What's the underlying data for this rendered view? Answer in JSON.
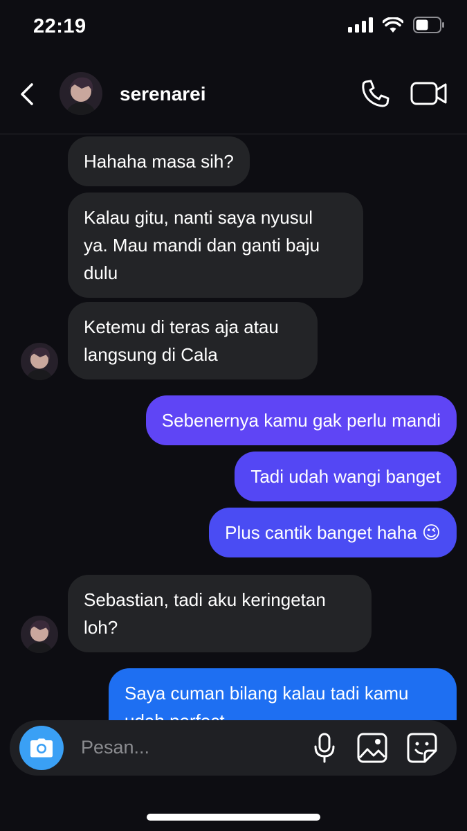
{
  "status": {
    "time": "22:19"
  },
  "header": {
    "username": "serenarei",
    "back_icon": "chevron-left-icon",
    "call_icon": "phone-icon",
    "video_icon": "video-camera-icon"
  },
  "messages": [
    {
      "from": "them",
      "text": "Hahaha masa sih?"
    },
    {
      "from": "them",
      "lines": [
        "Kalau gitu, nanti saya nyusul",
        "ya. Mau mandi dan ganti baju",
        "dulu"
      ]
    },
    {
      "from": "them",
      "lines": [
        "Ketemu di teras aja atau",
        "langsung di Cala"
      ]
    },
    {
      "from": "me",
      "text": "Sebenernya kamu gak perlu mandi"
    },
    {
      "from": "me",
      "text": "Tadi udah wangi banget"
    },
    {
      "from": "me",
      "text": "Plus cantik banget haha 😉"
    },
    {
      "from": "them",
      "lines": [
        "Sebastian, tadi aku keringetan",
        "loh?"
      ]
    },
    {
      "from": "me",
      "lines": [
        "Saya cuman bilang kalau tadi kamu",
        "udah perfect"
      ]
    }
  ],
  "composer": {
    "placeholder": "Pesan...",
    "camera_icon": "camera-icon",
    "mic_icon": "microphone-icon",
    "gallery_icon": "image-icon",
    "sticker_icon": "sticker-icon"
  },
  "colors": {
    "background": "#0d0d12",
    "incoming_bubble": "#232427",
    "outgoing_purple": "#6441f5",
    "outgoing_blue": "#1e6ff2",
    "camera_button": "#3aa0f5"
  }
}
